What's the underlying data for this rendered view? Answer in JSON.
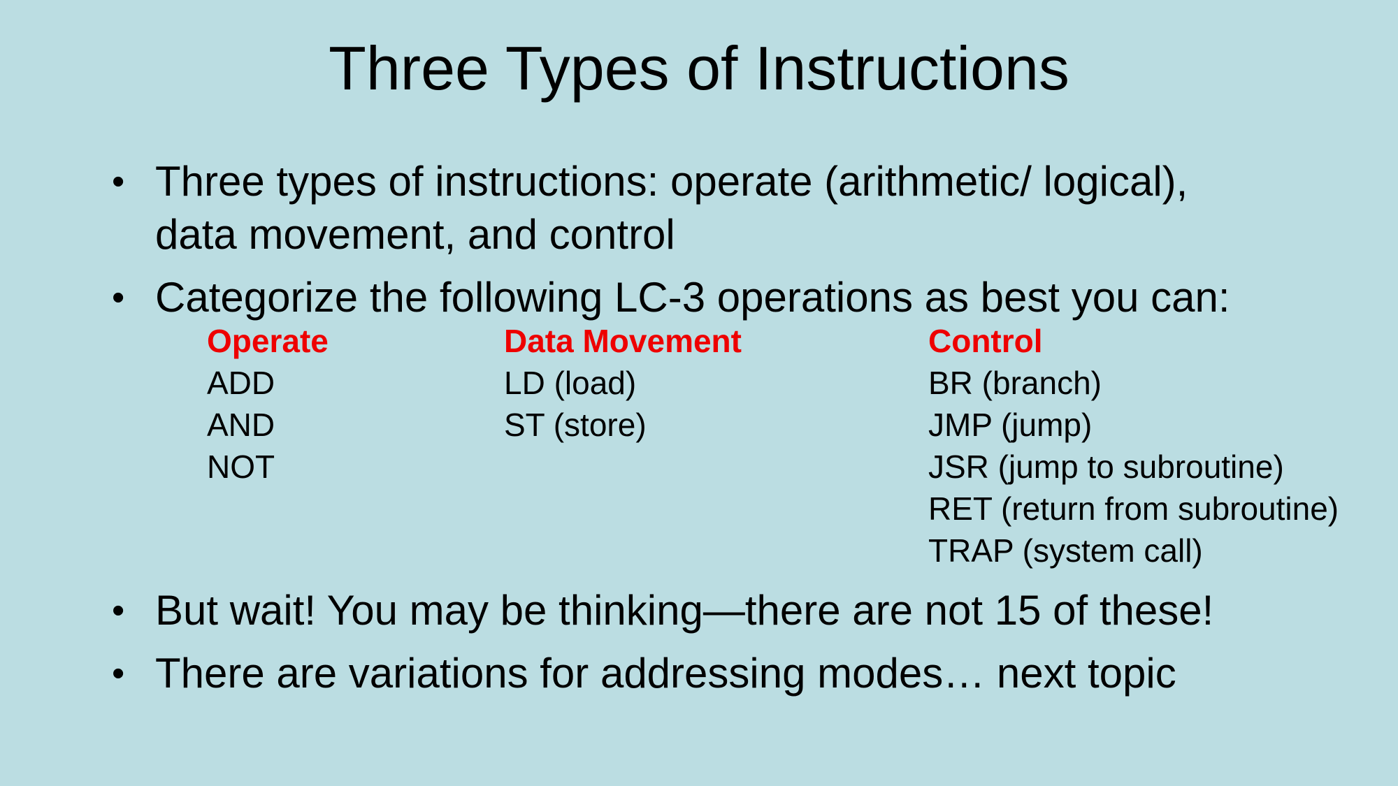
{
  "slide": {
    "title": "Three Types of Instructions",
    "bullet_char": "•",
    "bullets": [
      {
        "line1": "Three types of instructions: operate (arithmetic/ logical),",
        "line2": "data movement, and control"
      },
      {
        "line1": "Categorize the following LC-3 operations as best you can:"
      },
      {
        "line1": "But wait! You may be thinking—there are not 15 of these!"
      },
      {
        "line1": "There are variations for addressing modes… next topic"
      }
    ],
    "categories": [
      {
        "heading": "Operate",
        "items": [
          "ADD",
          "AND",
          "NOT"
        ]
      },
      {
        "heading": "Data Movement",
        "items": [
          "LD (load)",
          "ST (store)"
        ]
      },
      {
        "heading": "Control",
        "items": [
          "BR (branch)",
          "JMP (jump)",
          "JSR (jump to subroutine)",
          "RET (return from subroutine)",
          "TRAP (system call)"
        ]
      }
    ],
    "colors": {
      "background": "#bbdde2",
      "heading": "#ee0000",
      "text": "#000000"
    }
  }
}
